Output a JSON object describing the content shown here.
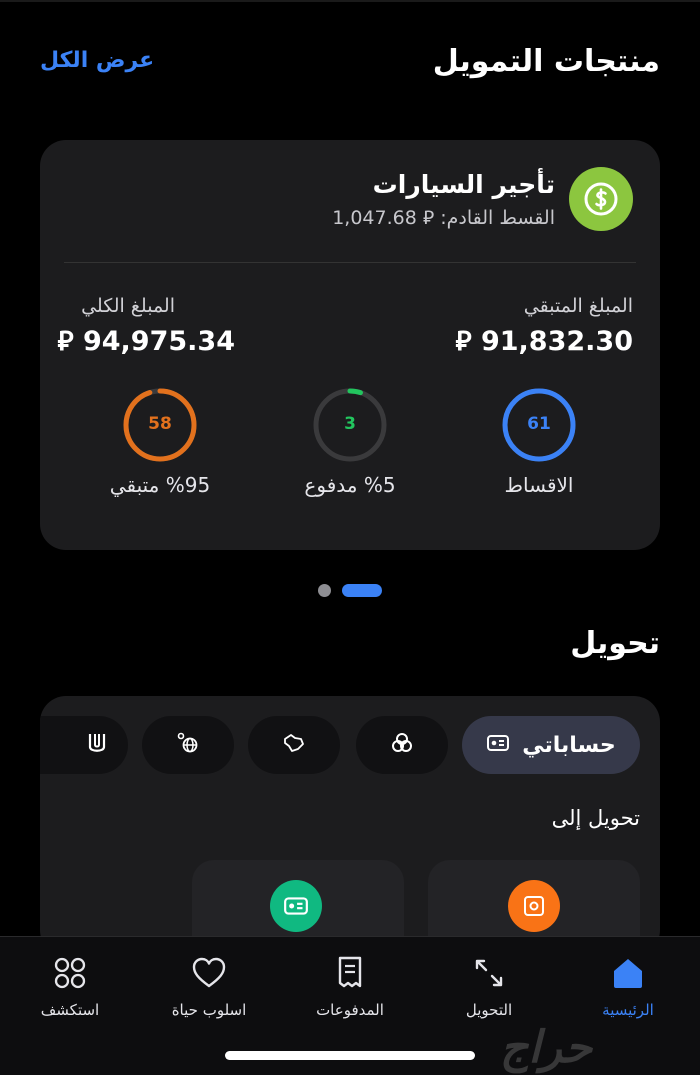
{
  "financing": {
    "title": "منتجات التمويل",
    "view_all": "عرض الكل",
    "product": {
      "name": "تأجير السيارات",
      "next_installment": "القسط القادم: ⃁ 1,047.68",
      "remaining_label": "المبلغ المتبقي",
      "remaining_value": "⃁ 91,832.30",
      "total_label": "المبلغ الكلي",
      "total_value": "⃁ 94,975.34",
      "rings": [
        {
          "value": "61",
          "caption": "الاقساط",
          "color": "#3b82f6",
          "progress": 1.0
        },
        {
          "value": "3",
          "caption": "%5 مدفوع",
          "color": "#22c55e",
          "progress": 0.05
        },
        {
          "value": "58",
          "caption": "%95 متبقي",
          "color": "#e2711d",
          "progress": 0.95
        }
      ]
    },
    "carousel": {
      "pages": 2,
      "active": 1
    }
  },
  "transfer": {
    "title": "تحويل",
    "chips": [
      {
        "label": "حساباتي",
        "icon": "id-card-icon",
        "active": true
      },
      {
        "label": "",
        "icon": "rings-icon",
        "active": false
      },
      {
        "label": "",
        "icon": "saudi-map-icon",
        "active": false
      },
      {
        "label": "",
        "icon": "international-transfer-icon",
        "active": false
      },
      {
        "label": "",
        "icon": "western-union-icon",
        "active": false
      }
    ],
    "subtitle": "تحويل إلى",
    "tiles": [
      {
        "icon": "safe-icon",
        "color": "#f97316"
      },
      {
        "icon": "id-card-icon",
        "color": "#10b981"
      }
    ]
  },
  "nav": {
    "items": [
      {
        "label": "الرئيسية",
        "icon": "home-icon",
        "active": true
      },
      {
        "label": "التحويل",
        "icon": "arrows-icon",
        "active": false
      },
      {
        "label": "المدفوعات",
        "icon": "receipt-icon",
        "active": false
      },
      {
        "label": "اسلوب حياة",
        "icon": "heart-icon",
        "active": false
      },
      {
        "label": "استكشف",
        "icon": "grid-icon",
        "active": false
      }
    ]
  },
  "watermark": "حراج",
  "colors": {
    "accent": "#3b82f6",
    "product_icon": "#8cc63f"
  }
}
